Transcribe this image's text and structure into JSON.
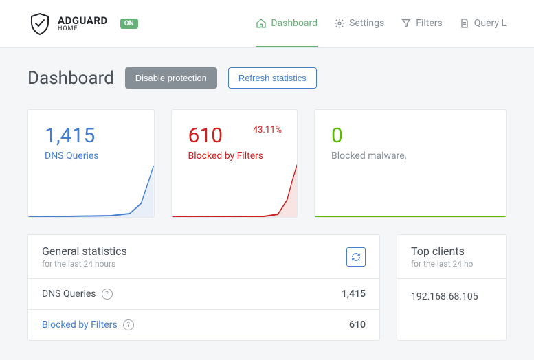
{
  "brand": {
    "main": "ADGUARD",
    "sub": "HOME",
    "status": "ON"
  },
  "nav": {
    "dashboard": "Dashboard",
    "settings": "Settings",
    "filters": "Filters",
    "querylog": "Query L"
  },
  "page": {
    "title": "Dashboard",
    "disable_btn": "Disable protection",
    "refresh_btn": "Refresh statistics"
  },
  "cards": {
    "dns": {
      "value": "1,415",
      "label": "DNS Queries"
    },
    "blocked": {
      "value": "610",
      "label": "Blocked by Filters",
      "pct": "43.11%"
    },
    "malware": {
      "value": "0",
      "label": "Blocked malware,"
    }
  },
  "general": {
    "title": "General statistics",
    "sub": "for the last 24 hours",
    "rows": [
      {
        "label": "DNS Queries",
        "value": "1,415",
        "link": false
      },
      {
        "label": "Blocked by Filters",
        "value": "610",
        "link": true
      }
    ]
  },
  "topclients": {
    "title": "Top clients",
    "sub": "for the last 24 ho",
    "items": [
      "192.168.68.105"
    ]
  },
  "colors": {
    "blue": "#467fcf",
    "red": "#cd201f",
    "green": "#5eba00"
  }
}
